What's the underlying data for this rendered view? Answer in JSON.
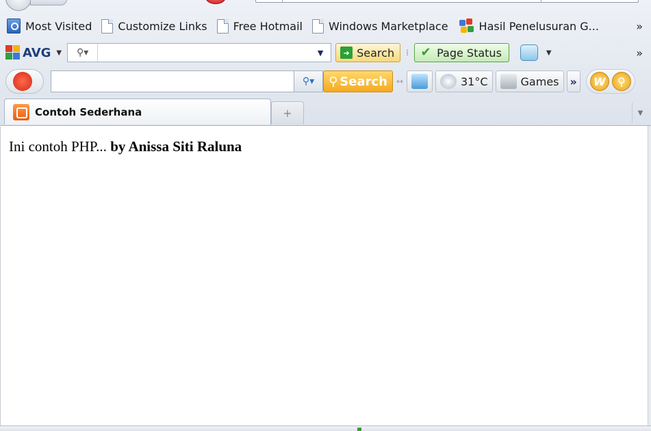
{
  "bookmarks": {
    "items": [
      {
        "label": "Most Visited",
        "icon": "most-visited-icon"
      },
      {
        "label": "Customize Links",
        "icon": "page-icon"
      },
      {
        "label": "Free Hotmail",
        "icon": "page-icon"
      },
      {
        "label": "Windows Marketplace",
        "icon": "page-icon"
      },
      {
        "label": "Hasil Penelusuran G...",
        "icon": "google-icon"
      }
    ],
    "overflow": "»"
  },
  "avg_toolbar": {
    "brand": "AVG",
    "search_value": "",
    "search_button": "Search",
    "page_status_button": "Page Status",
    "overflow": "»"
  },
  "third_toolbar": {
    "search_value": "",
    "search_button": "Search",
    "weather": "31°C",
    "games": "Games",
    "overflow": "»"
  },
  "tabs": {
    "active_title": "Contoh Sederhana",
    "new_tab_symbol": "+"
  },
  "page": {
    "text_normal": "Ini contoh PHP... ",
    "text_bold": "by Anissa Siti Raluna"
  },
  "colors": {
    "accent_green": "#2aa137",
    "accent_orange": "#f5a91f",
    "tab_icon": "#e85d12"
  }
}
